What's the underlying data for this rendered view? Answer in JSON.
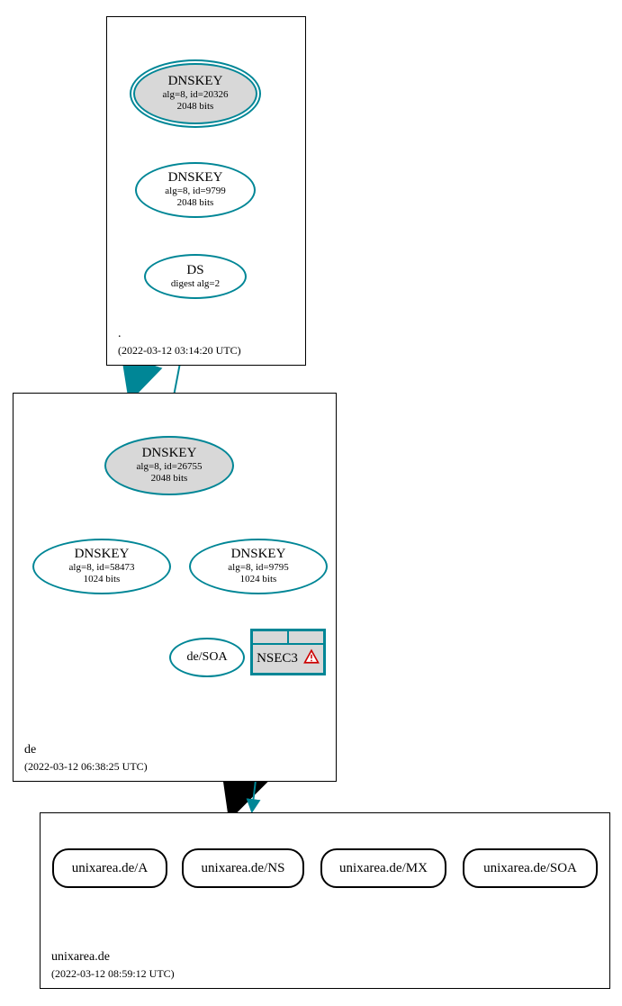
{
  "colors": {
    "teal": "#008696"
  },
  "zones": {
    "root": {
      "name": ".",
      "timestamp": "(2022-03-12 03:14:20 UTC)"
    },
    "de": {
      "name": "de",
      "timestamp": "(2022-03-12 06:38:25 UTC)"
    },
    "target": {
      "name": "unixarea.de",
      "timestamp": "(2022-03-12 08:59:12 UTC)"
    }
  },
  "nodes": {
    "root_ksk": {
      "title": "DNSKEY",
      "line2": "alg=8, id=20326",
      "line3": "2048 bits"
    },
    "root_zsk": {
      "title": "DNSKEY",
      "line2": "alg=8, id=9799",
      "line3": "2048 bits"
    },
    "root_ds": {
      "title": "DS",
      "line2": "digest alg=2"
    },
    "de_ksk": {
      "title": "DNSKEY",
      "line2": "alg=8, id=26755",
      "line3": "2048 bits"
    },
    "de_zsk_a": {
      "title": "DNSKEY",
      "line2": "alg=8, id=58473",
      "line3": "1024 bits"
    },
    "de_zsk_b": {
      "title": "DNSKEY",
      "line2": "alg=8, id=9795",
      "line3": "1024 bits"
    },
    "de_soa": {
      "label": "de/SOA"
    },
    "de_nsec3": {
      "label": "NSEC3"
    }
  },
  "records": {
    "a": "unixarea.de/A",
    "ns": "unixarea.de/NS",
    "mx": "unixarea.de/MX",
    "soa": "unixarea.de/SOA"
  },
  "warning_icon": "warning-triangle-icon"
}
